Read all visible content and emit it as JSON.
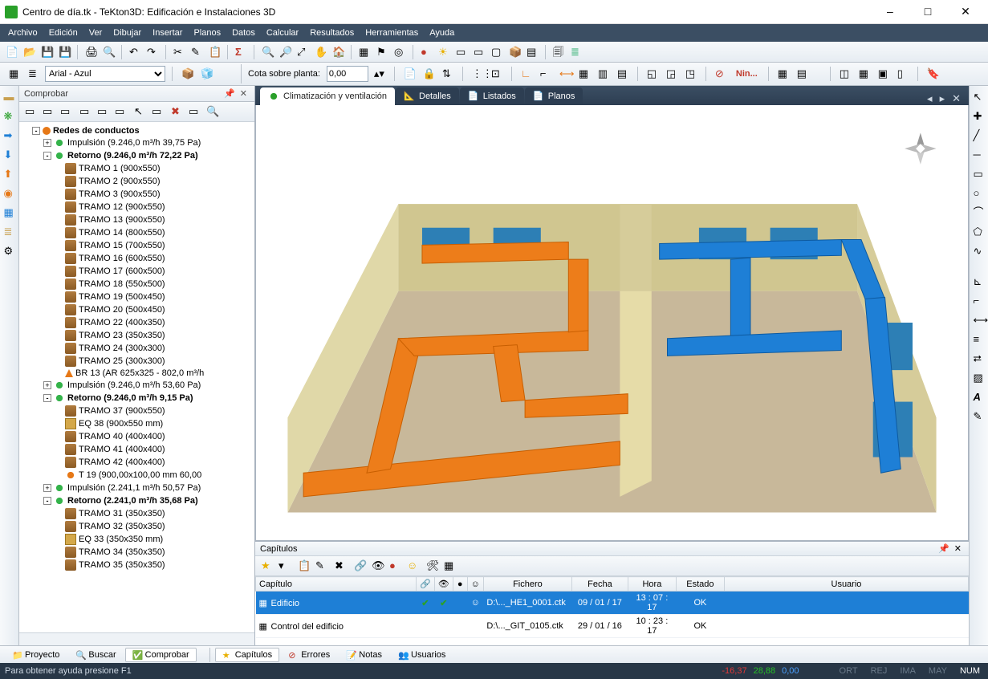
{
  "window": {
    "title": "Centro de día.tk - TeKton3D: Edificación e Instalaciones 3D"
  },
  "menu": [
    "Archivo",
    "Edición",
    "Ver",
    "Dibujar",
    "Insertar",
    "Planos",
    "Datos",
    "Calcular",
    "Resultados",
    "Herramientas",
    "Ayuda"
  ],
  "font_combo": "Arial - Azul",
  "cota": {
    "label": "Cota sobre planta:",
    "value": "0,00",
    "nin": "Nin..."
  },
  "left": {
    "panel_title": "Comprobar",
    "root": "Redes de conductos",
    "impulsion1": "Impulsión (9.246,0 m³/h 39,75 Pa)",
    "retorno1": "Retorno (9.246,0 m³/h 72,22 Pa)",
    "tramos1": [
      "TRAMO 1 (900x550)",
      "TRAMO 2 (900x550)",
      "TRAMO 3 (900x550)",
      "TRAMO 12 (900x550)",
      "TRAMO 13 (900x550)",
      "TRAMO 14 (800x550)",
      "TRAMO 15 (700x550)",
      "TRAMO 16 (600x550)",
      "TRAMO 17 (600x500)",
      "TRAMO 18 (550x500)",
      "TRAMO 19 (500x450)",
      "TRAMO 20 (500x450)",
      "TRAMO 22 (400x350)",
      "TRAMO 23 (350x350)",
      "TRAMO 24 (300x300)",
      "TRAMO 25 (300x300)"
    ],
    "br13": "BR 13 (AR 625x325 - 802,0 m³/h",
    "impulsion2": "Impulsión (9.246,0 m³/h 53,60 Pa)",
    "retorno2": "Retorno (9.246,0 m³/h 9,15 Pa)",
    "tramos2a": [
      "TRAMO 37 (900x550)"
    ],
    "eq38": "EQ 38 (900x550 mm)",
    "tramos2b": [
      "TRAMO 40 (400x400)",
      "TRAMO 41 (400x400)",
      "TRAMO 42 (400x400)"
    ],
    "t19": "T 19 (900,00x100,00 mm 60,00",
    "impulsion3": "Impulsión (2.241,1 m³/h 50,57 Pa)",
    "retorno3": "Retorno (2.241,0 m³/h 35,68 Pa)",
    "tramos3a": [
      "TRAMO 31 (350x350)",
      "TRAMO 32 (350x350)"
    ],
    "eq33": "EQ 33 (350x350 mm)",
    "tramos3b": [
      "TRAMO 34 (350x350)",
      "TRAMO 35 (350x350)"
    ]
  },
  "tabs": {
    "t1": "Climatización y ventilación",
    "t2": "Detalles",
    "t3": "Listados",
    "t4": "Planos"
  },
  "capitulos": {
    "title": "Capítulos",
    "headers": {
      "capitulo": "Capítulo",
      "fichero": "Fichero",
      "fecha": "Fecha",
      "hora": "Hora",
      "estado": "Estado",
      "usuario": "Usuario"
    },
    "rows": [
      {
        "cap": "Edificio",
        "fich": "D:\\..._HE1_0001.ctk",
        "fecha": "09 / 01 / 17",
        "hora": "13 : 07 : 17",
        "estado": "OK",
        "sel": true,
        "ticks": true
      },
      {
        "cap": "Control del edificio",
        "fich": "D:\\..._GIT_0105.ctk",
        "fecha": "29 / 01 / 16",
        "hora": "10 : 23 : 17",
        "estado": "OK",
        "sel": false,
        "ticks": false
      }
    ]
  },
  "bottom_left": {
    "proyecto": "Proyecto",
    "buscar": "Buscar",
    "comprobar": "Comprobar"
  },
  "bottom_right": {
    "capitulos": "Capítulos",
    "errores": "Errores",
    "notas": "Notas",
    "usuarios": "Usuarios"
  },
  "status": {
    "help": "Para obtener ayuda presione F1",
    "x": "-16,37",
    "y": "28,88",
    "z": "0,00",
    "cells": [
      "ORT",
      "REJ",
      "IMA",
      "MAY",
      "NUM"
    ]
  }
}
